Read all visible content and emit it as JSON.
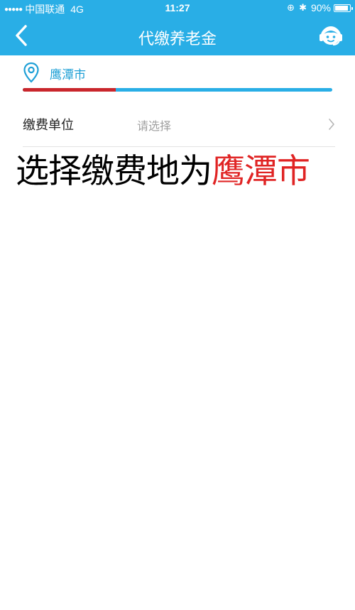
{
  "status_bar": {
    "signal": "●●●●●",
    "carrier": "中国联通",
    "network": "4G",
    "time": "11:27",
    "lock_glyph": "⊕",
    "bluetooth_glyph": "✱",
    "battery_text": "90%",
    "battery_level": 0.9
  },
  "nav": {
    "title": "代缴养老金",
    "back_icon": "chevron-left-icon",
    "service_icon": "customer-service-icon"
  },
  "location": {
    "label": "鹰潭市",
    "icon": "location-pin-icon",
    "progress": 0.3
  },
  "form": {
    "label": "缴费单位",
    "placeholder": "请选择",
    "icon": "chevron-right-icon"
  },
  "caption": {
    "prefix": "选择缴费地为",
    "highlight": "鹰潭市"
  },
  "colors": {
    "primary": "#29aee6",
    "accent_text": "#1fa0d6",
    "progress_red": "#c9262c",
    "highlight_red": "#e02424",
    "placeholder_gray": "#a0a0a0"
  }
}
